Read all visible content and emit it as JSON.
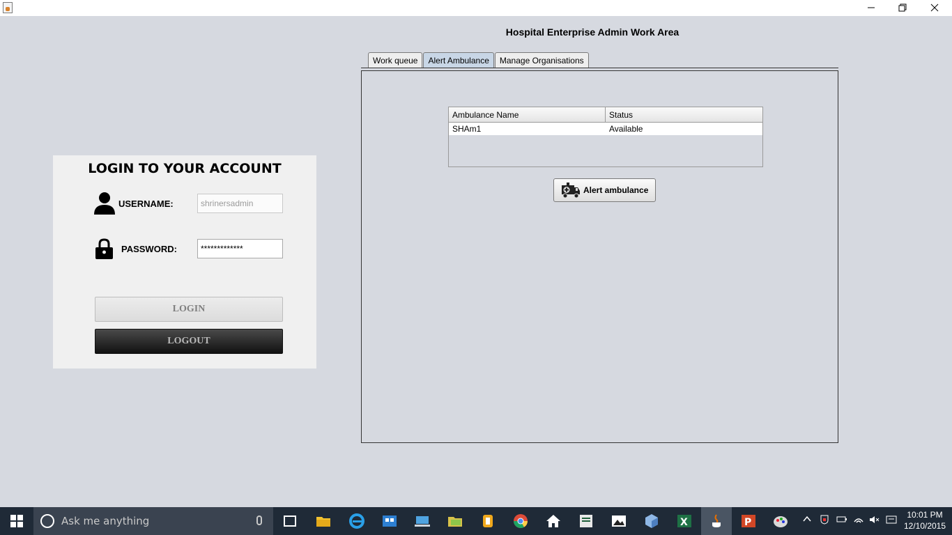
{
  "window": {
    "title": "",
    "controls": {
      "minimize": "minimize-icon",
      "maximize": "restore-icon",
      "close": "close-icon"
    }
  },
  "login": {
    "title": "LOGIN TO YOUR ACCOUNT",
    "username_label": "USERNAME:",
    "username_value": "shrinersadmin",
    "password_label": "PASSWORD:",
    "password_value": "*************",
    "login_button": "LOGIN",
    "logout_button": "LOGOUT"
  },
  "work_area": {
    "title": "Hospital Enterprise Admin Work Area",
    "tabs": [
      {
        "label": "Work queue",
        "active": false
      },
      {
        "label": "Alert Ambulance",
        "active": true
      },
      {
        "label": "Manage Organisations",
        "active": false
      }
    ],
    "table": {
      "columns": [
        "Ambulance Name",
        "Status"
      ],
      "rows": [
        [
          "SHAm1",
          "Available"
        ]
      ]
    },
    "alert_button": "Alert ambulance"
  },
  "taskbar": {
    "search_placeholder": "Ask me anything",
    "clock_time": "10:01 PM",
    "clock_date": "12/10/2015"
  },
  "colors": {
    "background": "#d6d9e0",
    "active_tab": "#c8d6e6",
    "taskbar": "#1f2a37"
  }
}
